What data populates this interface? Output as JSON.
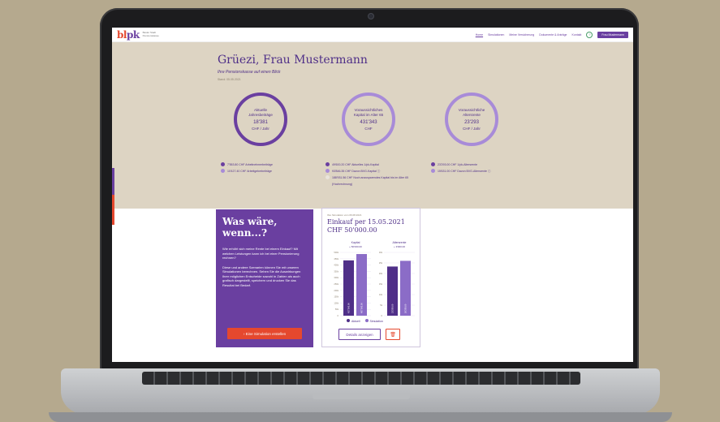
{
  "nav": {
    "logo_b": "bl",
    "logo_rest": "pk",
    "logo_tagline": "Basler Stadt Pensionskasse",
    "links": [
      "Home",
      "Simulationen",
      "Meine Versicherung",
      "Dokumente & Anträge",
      "Kontakt"
    ],
    "help_icon": "?",
    "user_button": "Frau Mustermann"
  },
  "hero": {
    "greeting": "Grüezi, Frau Mustermann",
    "subtitle": "Ihre Pensionskasse auf einen Blick",
    "stand": "Stand: 05.05.2021",
    "circles": [
      {
        "label": "Aktuelle Jahresbeiträge",
        "value": "18'381",
        "unit": "CHF / Jahr"
      },
      {
        "label": "Voraussichtliches Kapital im Alter 65",
        "value": "431'343",
        "unit": "CHF"
      },
      {
        "label": "Voraussichtliche Altersrente",
        "value": "23'293",
        "unit": "CHF / Jahr"
      }
    ],
    "legend1": [
      "7'553.80 CHF Arbeitnehmerbeiträge",
      "10'427.40 CHF Arbeitgeberbeiträge"
    ],
    "legend2": [
      "49'600.20 CHF Aktuelles 1/pk-Kapital",
      "93'846.35 CHF Davon BVG-Kapital ⓘ",
      "188'931.56 CHF Noch anzusparendes Kapital bis im Alter 65 (Hochrechnung)"
    ],
    "legend3": [
      "23'293.00 CHF 1/pk-Altersrente",
      "15'631.00 CHF Davon BVG-Altersrente ⓘ"
    ]
  },
  "whatif": {
    "title_line1": "Was wäre,",
    "title_line2": "wenn...?",
    "questions": "Wie erhöht sich meine Rente bei einem Einkauf? Mit welchen Leistungen kann ich bei einer Pensionierung rechnen?",
    "text": "Diese und andere Szenarien können Sie mit unseren Simulationen berechnen. Sehen Sie die Auswirkungen Ihrer möglichen Entscheide sowohl in Zahlen als auch grafisch dargestellt, speichern und drucken Sie das Resultat bei Bedarf.",
    "button": "Eine Simulation erstellen"
  },
  "simulation": {
    "small": "Ihre Simulation vom 06.08.2021",
    "title": "Einkauf per 15.05.2021",
    "amount": "CHF 50'000.00",
    "details_button": "Details anzeigen",
    "delete_icon": "🗑",
    "legend": [
      "Aktuell",
      "Simulation"
    ]
  },
  "chart_data": [
    {
      "type": "bar",
      "title": "Kapital",
      "categories": [
        "Aktuell",
        "Simulation"
      ],
      "values": [
        437000,
        487000
      ],
      "ylim": [
        0,
        500000
      ],
      "yticks": [
        "0",
        "50k",
        "100k",
        "150k",
        "200k",
        "250k",
        "300k",
        "350k",
        "400k",
        "450k",
        "500k"
      ],
      "data_labels": [
        "437'343.00",
        "487'343.00"
      ],
      "subtitle": "+ 50'000.00"
    },
    {
      "type": "bar",
      "title": "Altersrente",
      "categories": [
        "Aktuell",
        "Simulation"
      ],
      "values": [
        23300,
        26000
      ],
      "ylim": [
        0,
        30000
      ],
      "yticks": [
        "0",
        "5k",
        "10k",
        "15k",
        "20k",
        "25k",
        "30k"
      ],
      "data_labels": [
        "23'293.00",
        "26'293.00"
      ],
      "subtitle": "+ 3'000.00"
    }
  ],
  "colors": {
    "purple": "#6a3fa0",
    "light_purple": "#a88bd8",
    "orange": "#e5482e",
    "beige": "#ddd4c3"
  }
}
